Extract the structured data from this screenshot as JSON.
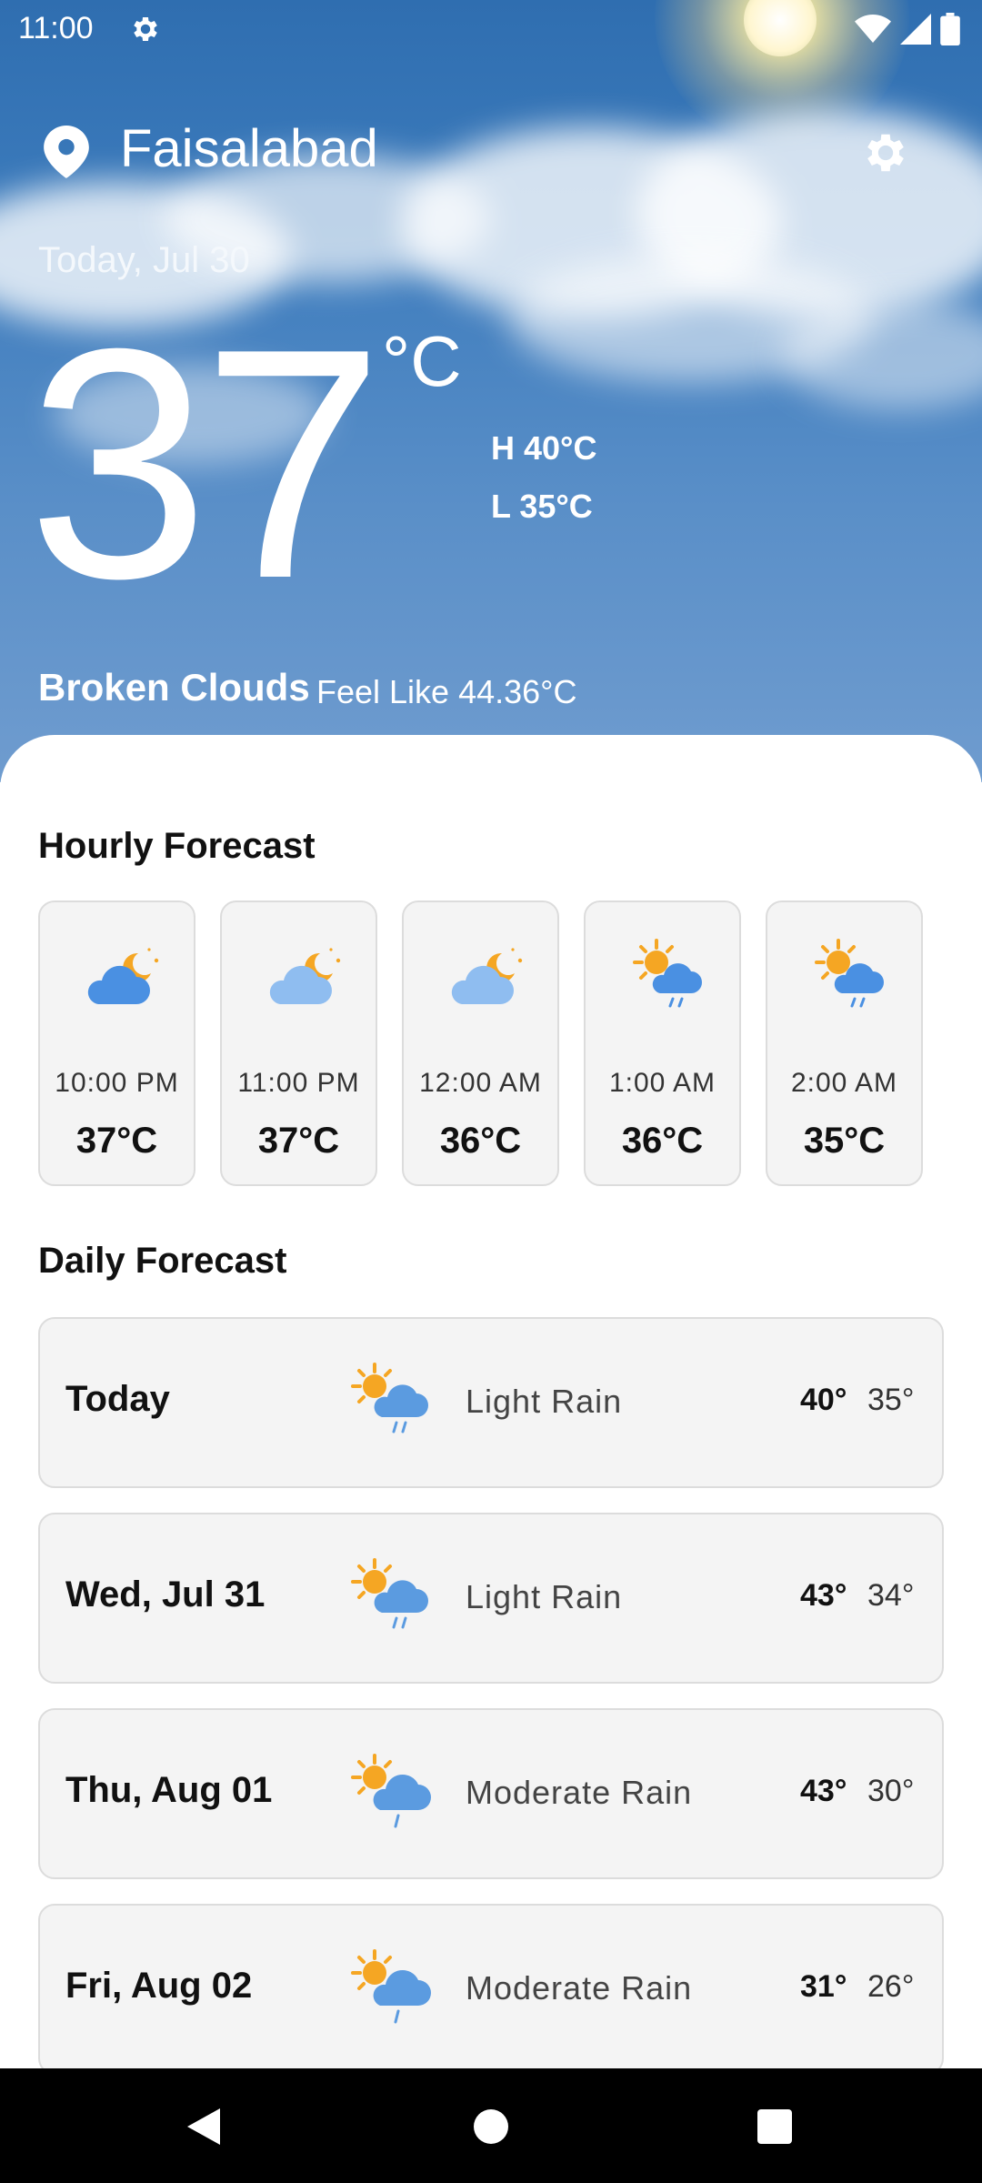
{
  "status_bar": {
    "time": "11:00"
  },
  "header": {
    "city": "Faisalabad",
    "date": "Today, Jul 30",
    "temperature": "37",
    "unit": "°C",
    "high": "H 40°C",
    "low": "L 35°C",
    "condition": "Broken Clouds",
    "feels_like": "Feel Like 44.36°C"
  },
  "hourly": {
    "title": "Hourly Forecast",
    "items": [
      {
        "time": "10:00 PM",
        "temp": "37°C",
        "icon": "cloudy-night-icon"
      },
      {
        "time": "11:00 PM",
        "temp": "37°C",
        "icon": "cloudy-night-icon"
      },
      {
        "time": "12:00 AM",
        "temp": "36°C",
        "icon": "cloudy-night-icon"
      },
      {
        "time": "1:00 AM",
        "temp": "36°C",
        "icon": "sun-rain-icon"
      },
      {
        "time": "2:00 AM",
        "temp": "35°C",
        "icon": "sun-rain-icon"
      }
    ]
  },
  "daily": {
    "title": "Daily Forecast",
    "items": [
      {
        "day": "Today",
        "desc": "Light Rain",
        "high": "40°",
        "low": "35°",
        "icon": "sun-rain-icon"
      },
      {
        "day": "Wed, Jul 31",
        "desc": "Light Rain",
        "high": "43°",
        "low": "34°",
        "icon": "sun-rain-icon"
      },
      {
        "day": "Thu, Aug 01",
        "desc": "Moderate Rain",
        "high": "43°",
        "low": "30°",
        "icon": "sun-rain-icon"
      },
      {
        "day": "Fri, Aug 02",
        "desc": "Moderate Rain",
        "high": "31°",
        "low": "26°",
        "icon": "sun-rain-icon"
      }
    ]
  },
  "colors": {
    "sky": "#3d7cbd",
    "sun": "#f5a623",
    "cloud": "#5b9be0",
    "card": "#f4f4f4"
  }
}
